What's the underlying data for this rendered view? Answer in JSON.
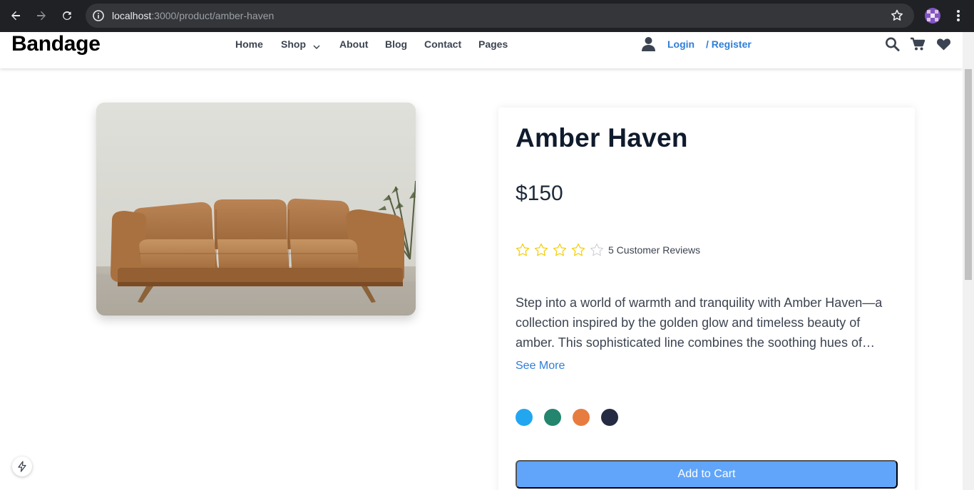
{
  "browser": {
    "url_host": "localhost",
    "url_path": ":3000/product/amber-haven",
    "icons": [
      "back-icon",
      "forward-icon",
      "reload-icon",
      "info-icon",
      "star-icon",
      "profile-avatar",
      "kebab-menu-icon"
    ]
  },
  "header": {
    "brand": "Bandage",
    "nav": {
      "home": "Home",
      "shop": "Shop",
      "about": "About",
      "blog": "Blog",
      "contact": "Contact",
      "pages": "Pages"
    },
    "login": "Login",
    "register": "/ Register",
    "icons": [
      "user-icon",
      "search-icon",
      "cart-icon",
      "heart-icon"
    ]
  },
  "product": {
    "title": "Amber Haven",
    "price": "$150",
    "rating": 4,
    "rating_max": 5,
    "reviews": "5 Customer Reviews",
    "description": "Step into a world of warmth and tranquility with Amber Haven—a collection inspired by the golden glow and timeless beauty of amber. This sophisticated line combines the soothing hues of…",
    "see_more": "See More",
    "colors": [
      "#23a6f0",
      "#23856d",
      "#e77c40",
      "#252b42"
    ],
    "add_to_cart": "Add to Cart"
  },
  "colors": {
    "accent": "#2f7ed8",
    "button": "#60a5fa",
    "star": "#f3cd03"
  }
}
